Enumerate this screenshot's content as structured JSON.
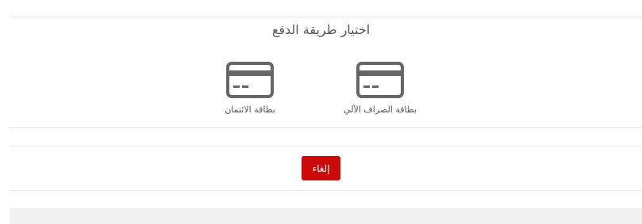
{
  "dialog": {
    "title": "اختيار طريقة الدفع"
  },
  "methods": [
    {
      "id": "atm",
      "label": "بطاقة الصراف الآلي",
      "icon": "credit-card-icon"
    },
    {
      "id": "credit",
      "label": "بطاقة الائتمان",
      "icon": "credit-card-icon"
    }
  ],
  "actions": {
    "cancel_label": "إلغاء"
  },
  "colors": {
    "accent": "#cc0a0a",
    "icon": "#666666",
    "text": "#555555",
    "divider": "#e7e7e7",
    "footer": "#f1f1f1"
  }
}
